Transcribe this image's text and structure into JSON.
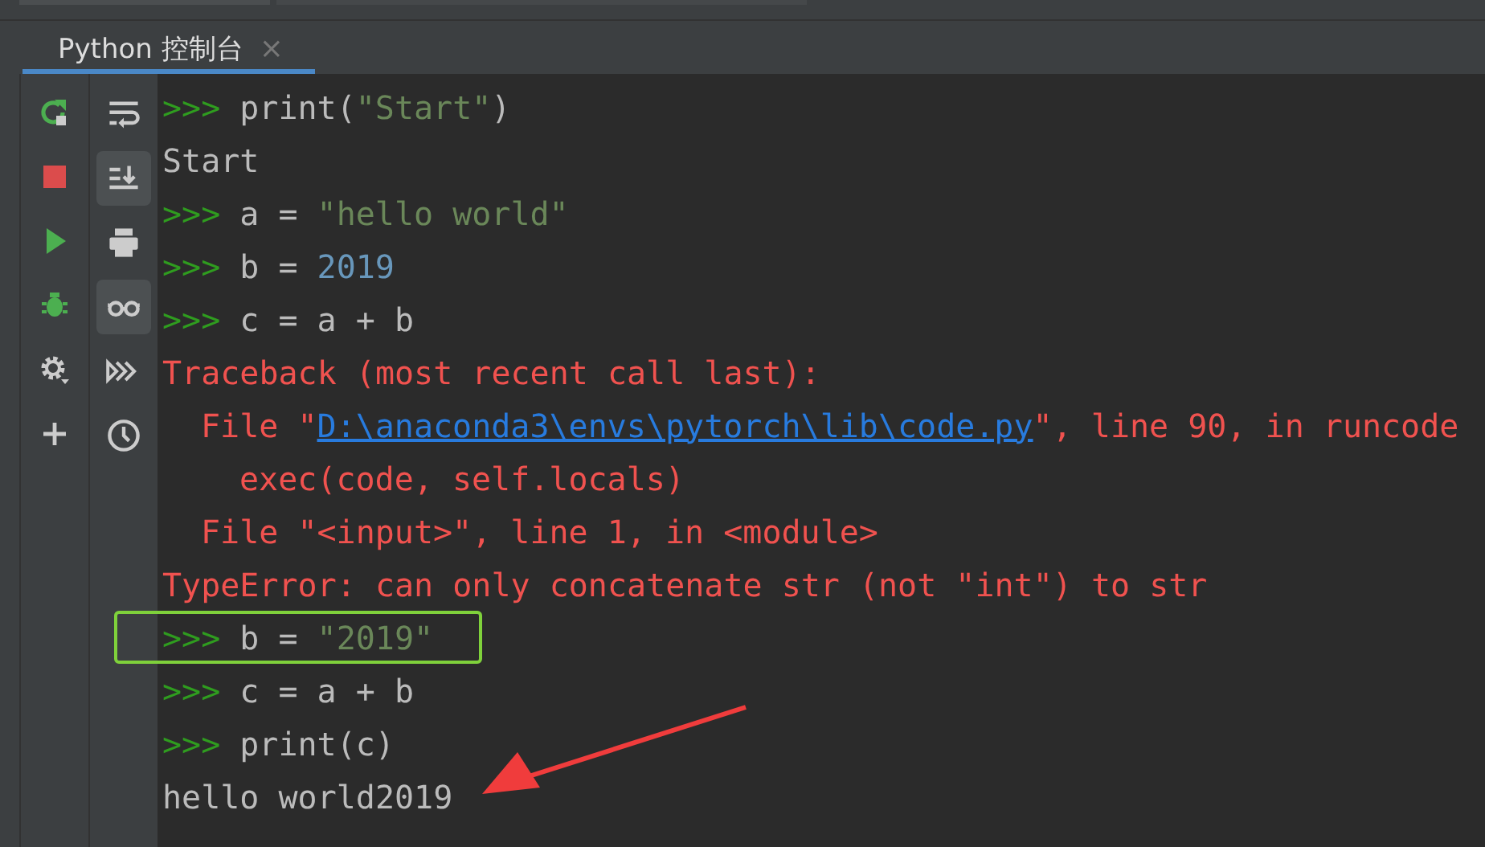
{
  "tab": {
    "label": "Python 控制台",
    "close": "×",
    "selected": true
  },
  "left_tools": [
    {
      "kind": "rerun"
    },
    {
      "kind": "stop"
    },
    {
      "kind": "run"
    },
    {
      "kind": "debug"
    },
    {
      "kind": "settings"
    },
    {
      "kind": "add"
    }
  ],
  "right_tools": [
    {
      "kind": "soft-wrap",
      "selected": false
    },
    {
      "kind": "scroll-end",
      "selected": true
    },
    {
      "kind": "print",
      "selected": false
    },
    {
      "kind": "variables",
      "selected": true
    },
    {
      "kind": "execute",
      "selected": false
    },
    {
      "kind": "history",
      "selected": false
    }
  ],
  "lines": [
    {
      "kind": "input",
      "prompt": ">>>",
      "highlighted": false,
      "parts": [
        {
          "kind": "code",
          "text": "print("
        },
        {
          "kind": "string",
          "text": "\"Start\""
        },
        {
          "kind": "code",
          "text": ")"
        }
      ]
    },
    {
      "kind": "output",
      "highlighted": false,
      "parts": [
        {
          "kind": "code",
          "text": "Start"
        }
      ]
    },
    {
      "kind": "input",
      "prompt": ">>>",
      "highlighted": false,
      "parts": [
        {
          "kind": "code",
          "text": "a = "
        },
        {
          "kind": "string",
          "text": "\"hello world\""
        }
      ]
    },
    {
      "kind": "input",
      "prompt": ">>>",
      "highlighted": false,
      "parts": [
        {
          "kind": "code",
          "text": "b = "
        },
        {
          "kind": "number",
          "text": "2019"
        }
      ]
    },
    {
      "kind": "input",
      "prompt": ">>>",
      "highlighted": false,
      "parts": [
        {
          "kind": "code",
          "text": "c = a + b"
        }
      ]
    },
    {
      "kind": "error",
      "highlighted": false,
      "parts": [
        {
          "kind": "error",
          "text": "Traceback (most recent call last):"
        }
      ]
    },
    {
      "kind": "error-frame",
      "highlighted": false,
      "parts": [
        {
          "kind": "error",
          "text": "File \""
        },
        {
          "kind": "link",
          "text": "D:\\anaconda3\\envs\\pytorch\\lib\\code.py"
        },
        {
          "kind": "error",
          "text": "\", line 90, in runcode"
        }
      ]
    },
    {
      "kind": "error-source",
      "highlighted": false,
      "parts": [
        {
          "kind": "error",
          "text": "exec(code, self.locals)"
        }
      ]
    },
    {
      "kind": "error-frame",
      "highlighted": false,
      "parts": [
        {
          "kind": "error",
          "text": "File \"<input>\", line 1, in <module>"
        }
      ]
    },
    {
      "kind": "error",
      "highlighted": false,
      "parts": [
        {
          "kind": "error",
          "text": "TypeError: can only concatenate str (not \"int\") to str"
        }
      ]
    },
    {
      "kind": "input",
      "prompt": ">>>",
      "highlighted": true,
      "parts": [
        {
          "kind": "code",
          "text": "b = "
        },
        {
          "kind": "string",
          "text": "\"2019\""
        }
      ]
    },
    {
      "kind": "input",
      "prompt": ">>>",
      "highlighted": false,
      "parts": [
        {
          "kind": "code",
          "text": "c = a + b"
        }
      ]
    },
    {
      "kind": "input",
      "prompt": ">>>",
      "highlighted": false,
      "parts": [
        {
          "kind": "code",
          "text": "print(c)"
        }
      ]
    },
    {
      "kind": "output",
      "highlighted": false,
      "parts": [
        {
          "kind": "code",
          "text": "hello world2019"
        }
      ]
    }
  ]
}
